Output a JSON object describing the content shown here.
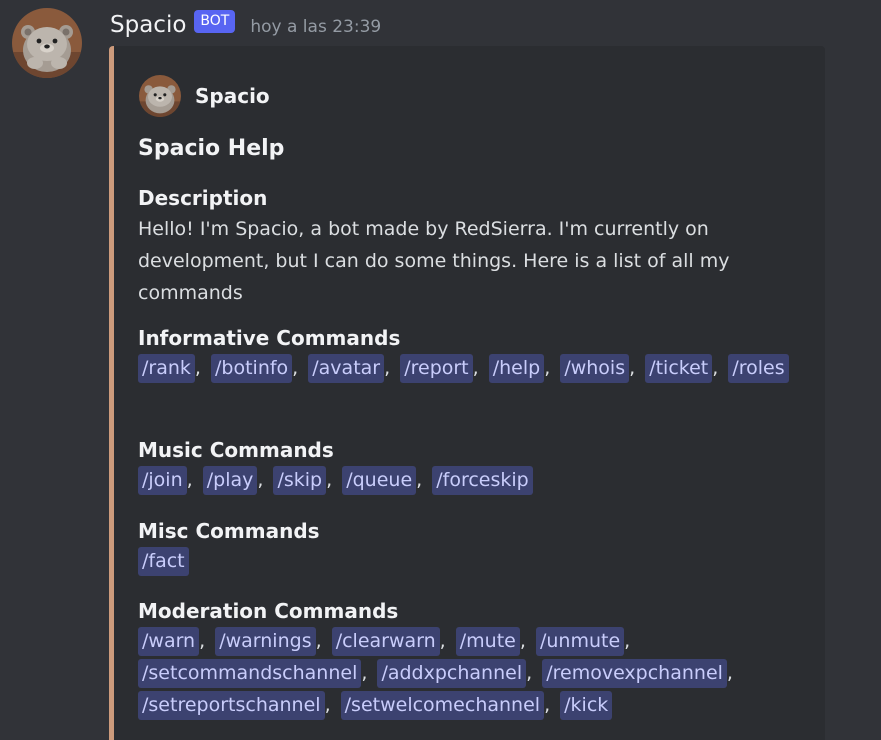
{
  "message": {
    "username": "Spacio",
    "bot_tag": "BOT",
    "timestamp": "hoy a las 23:39"
  },
  "embed": {
    "accent_color": "#cd9b7c",
    "author": "Spacio",
    "title": "Spacio Help",
    "description_label": "Description",
    "description": "Hello! I'm Spacio, a bot made by RedSierra. I'm currently on development, but I can do some things. Here is a list of all my commands",
    "sections": {
      "informative": {
        "label": "Informative Commands",
        "commands": [
          "/rank",
          "/botinfo",
          "/avatar",
          "/report",
          "/help",
          "/whois",
          "/ticket",
          "/roles"
        ]
      },
      "music": {
        "label": "Music Commands",
        "commands": [
          "/join",
          "/play",
          "/skip",
          "/queue",
          "/forceskip"
        ]
      },
      "misc": {
        "label": "Misc Commands",
        "commands": [
          "/fact"
        ]
      },
      "moderation": {
        "label": "Moderation Commands",
        "commands": [
          "/warn",
          "/warnings",
          "/clearwarn",
          "/mute",
          "/unmute",
          "/setcommandschannel",
          "/addxpchannel",
          "/removexpchannel",
          "/setreportschannel",
          "/setwelcomechannel",
          "/kick"
        ]
      }
    }
  },
  "colors": {
    "background": "#313338",
    "embed_background": "#2b2d31",
    "bot_tag": "#5865f2",
    "command_chip": "#3c4270"
  },
  "icons": {
    "avatar": "polar-bear-avatar-icon"
  }
}
